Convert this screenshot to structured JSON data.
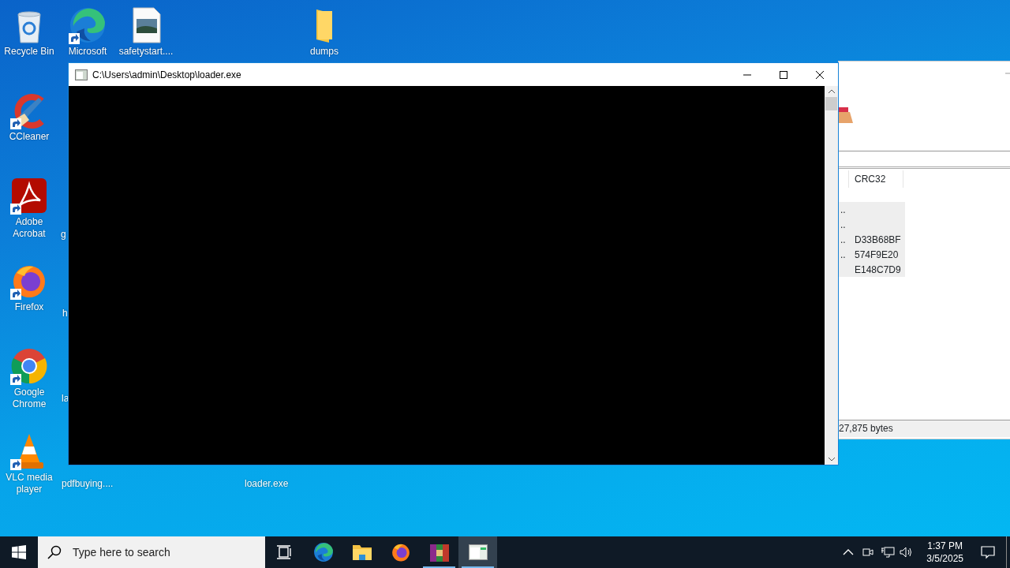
{
  "desktop_icons": [
    {
      "kind": "recycle-bin",
      "label": "Recycle Bin"
    },
    {
      "kind": "edge",
      "label": "Microsoft",
      "shortcut": true
    },
    {
      "kind": "image-file",
      "label": "safetystart...."
    },
    {
      "kind": "folder",
      "label": "dumps"
    },
    {
      "kind": "ccleaner",
      "label": "CCleaner",
      "shortcut": true
    },
    {
      "kind": "acrobat",
      "label": "Adobe Acrobat",
      "shortcut": true
    },
    {
      "kind": "hidden",
      "label": "g"
    },
    {
      "kind": "firefox",
      "label": "Firefox",
      "shortcut": true
    },
    {
      "kind": "hidden",
      "label": "h"
    },
    {
      "kind": "chrome",
      "label": "Google Chrome",
      "shortcut": true
    },
    {
      "kind": "hidden",
      "label": "la"
    },
    {
      "kind": "vlc",
      "label": "VLC media player",
      "shortcut": true
    },
    {
      "kind": "hidden",
      "label": "pdfbuying...."
    },
    {
      "kind": "hidden",
      "label": "loader.exe"
    }
  ],
  "archive_window": {
    "columns": [
      "CRC32"
    ],
    "rows": [
      {
        "column_1": "..",
        "selected": true
      },
      {
        "column_1": "..",
        "selected": true
      },
      {
        "column_1": "..",
        "crc32": "D33B68BF",
        "selected": true
      },
      {
        "column_1": "..",
        "crc32": "574F9E20",
        "selected": true
      },
      {
        "crc32": "E148C7D9",
        "selected": true
      }
    ],
    "status_bar": "27,875 bytes"
  },
  "console_window": {
    "title": "C:\\Users\\admin\\Desktop\\loader.exe",
    "active": true
  },
  "taskbar": {
    "search": {
      "placeholder": "Type here to search"
    },
    "apps": [
      {
        "kind": "task-view",
        "running": false,
        "selected": false
      },
      {
        "kind": "edge",
        "running": false,
        "selected": false
      },
      {
        "kind": "explorer",
        "running": false,
        "selected": false
      },
      {
        "kind": "firefox",
        "running": false,
        "selected": false
      },
      {
        "kind": "winrar",
        "running": true,
        "selected": false
      },
      {
        "kind": "console",
        "running": true,
        "selected": true
      }
    ],
    "time": "1:37 PM",
    "date": "3/5/2025"
  }
}
